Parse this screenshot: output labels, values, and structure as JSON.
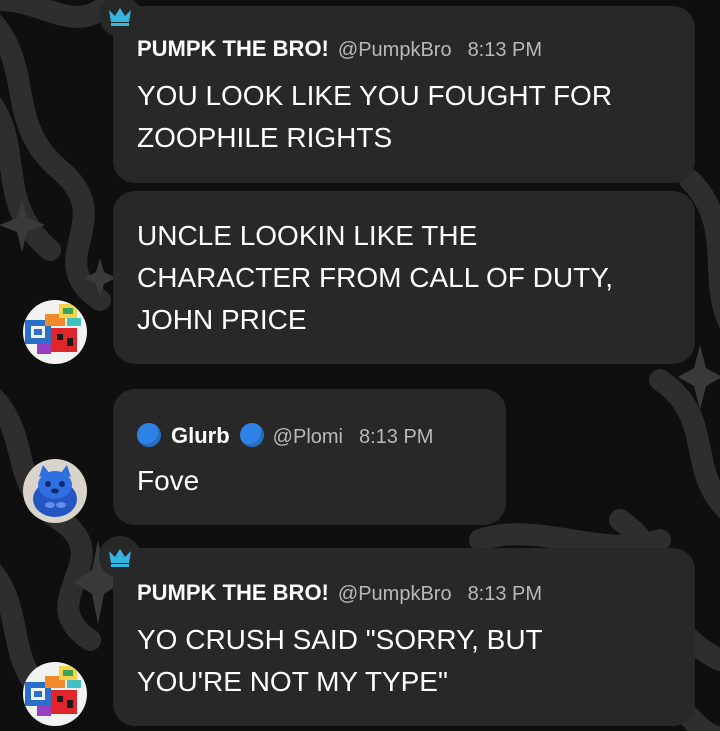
{
  "messages": [
    {
      "author": "PUMPK THE BRO!",
      "handle": "@PumpkBro",
      "time": "8:13 PM",
      "text": "YOU LOOK LIKE YOU FOUGHT FOR\nZOOPHILE RIGHTS",
      "badge_icon": "crown-icon"
    },
    {
      "text": "UNCLE LOOKIN LIKE THE\nCHARACTER FROM CALL OF DUTY,\nJOHN PRICE",
      "avatar_icon": "pixel-art-avatar"
    },
    {
      "author": "Glurb",
      "handle": "@Plomi",
      "time": "8:13 PM",
      "text": "Fove",
      "avatar_icon": "blue-cat-avatar"
    },
    {
      "author": "PUMPK THE BRO!",
      "handle": "@PumpkBro",
      "time": "8:13 PM",
      "text": "YO CRUSH SAID \"SORRY, BUT\nYOU'RE NOT MY TYPE\"",
      "badge_icon": "crown-icon",
      "avatar_icon": "pixel-art-avatar"
    }
  ],
  "colors": {
    "background": "#0f0f0f",
    "bubble": "#282828",
    "text": "#ffffff",
    "muted": "#b9b9b9",
    "crown": "#35b6e0",
    "glurb_dot": "#2d82e6"
  }
}
